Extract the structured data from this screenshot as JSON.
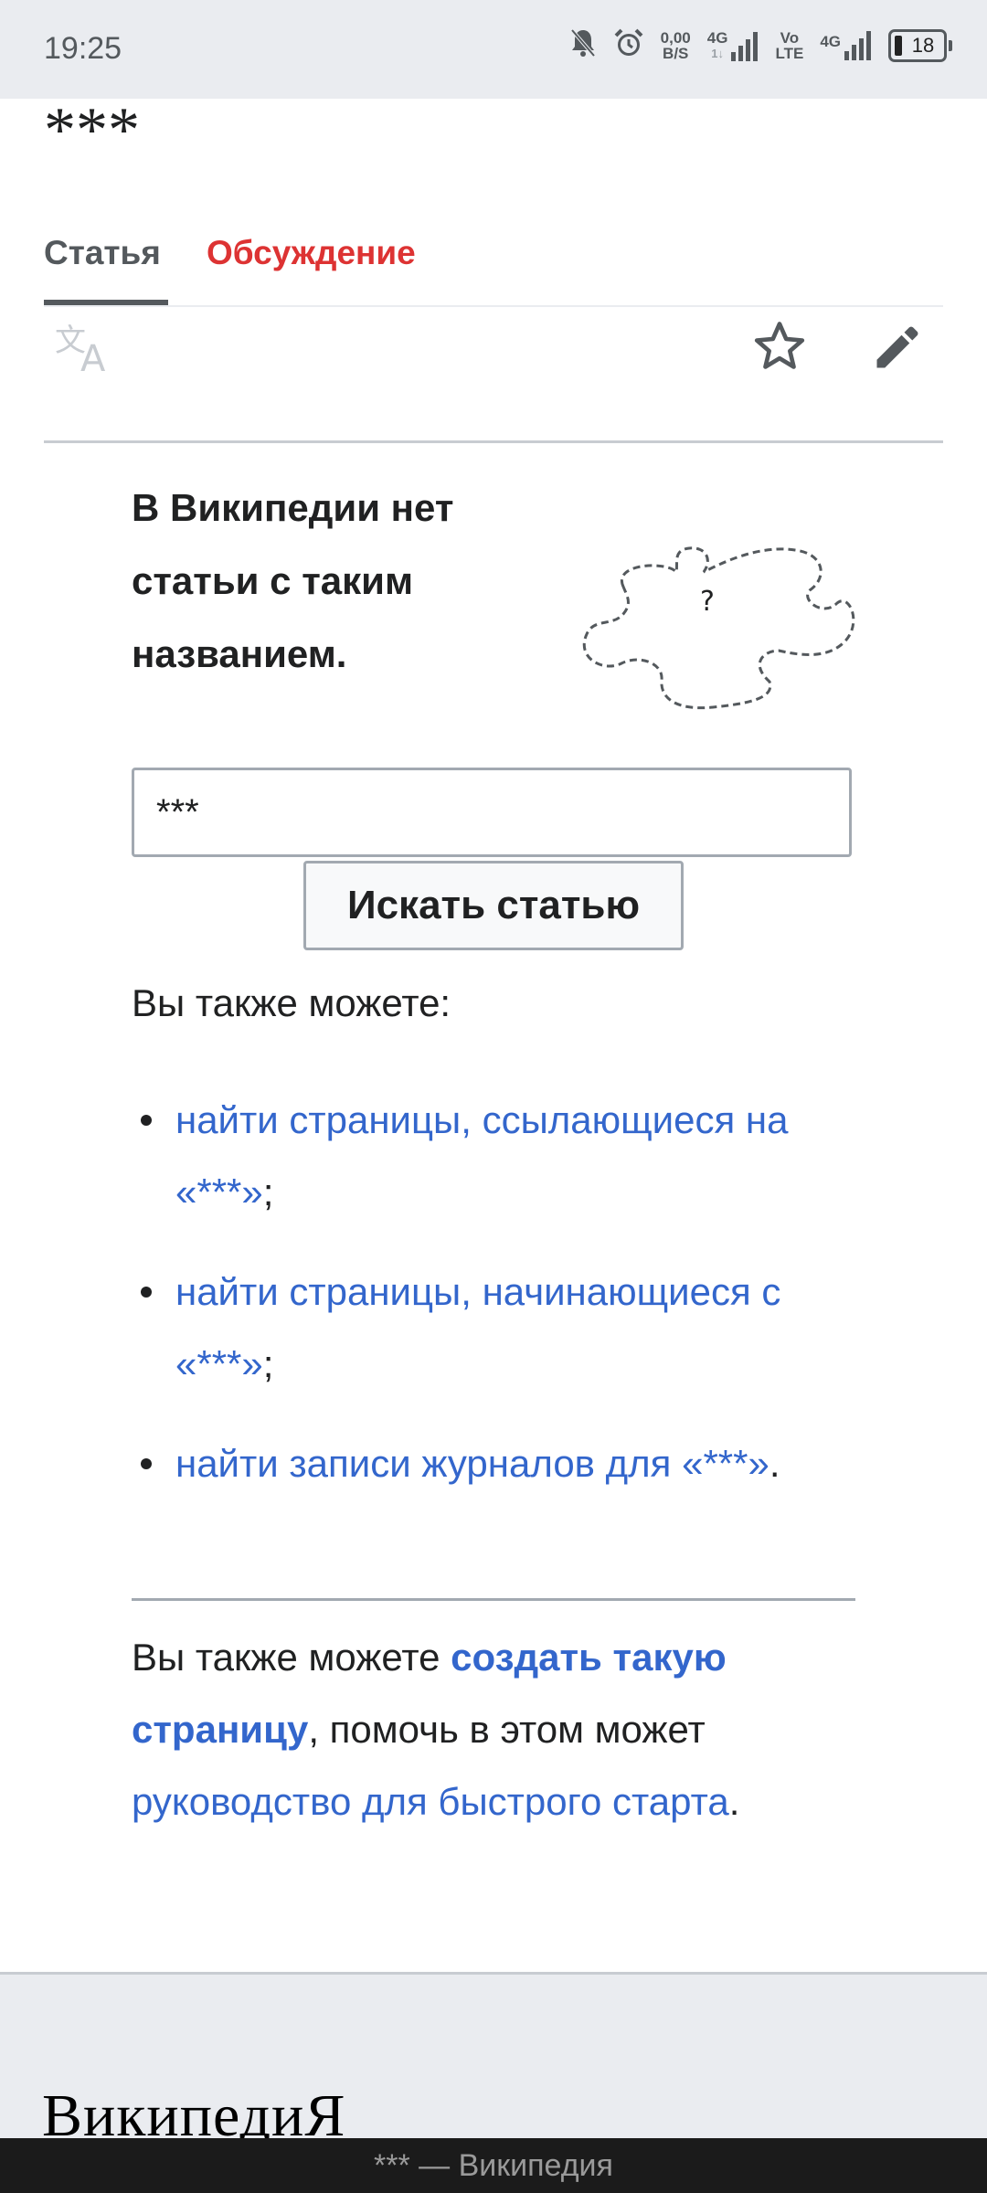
{
  "status_bar": {
    "time": "19:25",
    "net_speed_value": "0,00",
    "net_speed_unit": "B/S",
    "sim1_label": "4G",
    "sim1_sub": "1↓",
    "volte_top": "Vo",
    "volte_bottom": "LTE",
    "sim2_label": "4G",
    "battery": "18"
  },
  "page": {
    "title": "***"
  },
  "tabs": {
    "article": "Статья",
    "talk": "Обсуждение"
  },
  "toolbar": {
    "icons": [
      "translate-icon",
      "star-icon",
      "edit-pencil-icon"
    ]
  },
  "notice": {
    "text": "В Википедии нет статьи с таким названием."
  },
  "search": {
    "value": "***",
    "button_label": "Искать статью"
  },
  "also": {
    "intro": "Вы также можете:",
    "options": [
      {
        "link": "найти страницы, ссылающиеся на «***»",
        "suffix": ";"
      },
      {
        "link": "найти страницы, начинающиеся с «***»",
        "suffix": ";"
      },
      {
        "link": "найти записи журналов для «***»",
        "suffix": "."
      }
    ]
  },
  "create": {
    "prefix": "Вы также можете ",
    "create_link": "создать такую страницу",
    "middle": ", помочь в этом может ",
    "guide_link": "руководство для быстрого старта",
    "suffix": "."
  },
  "footer": {
    "wordmark": "ВикипедиЯ"
  },
  "bottom_bar": {
    "title": "*** — Википедия"
  },
  "colors": {
    "link": "#3366cc",
    "talk_tab": "#dd3333",
    "text": "#202122",
    "muted": "#54595d"
  }
}
